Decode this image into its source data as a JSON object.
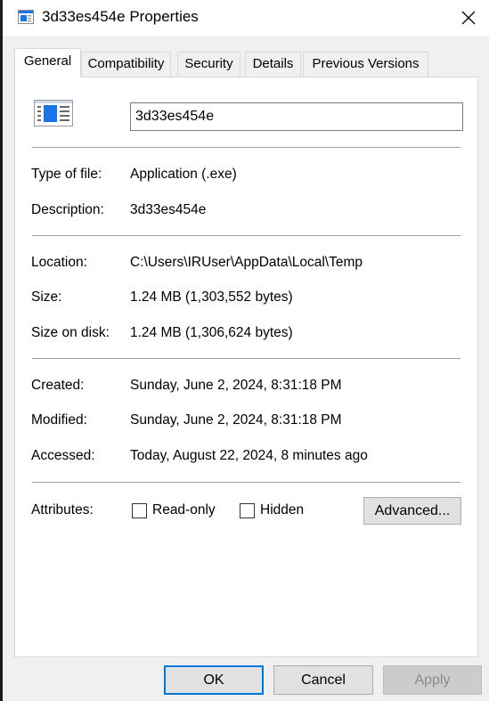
{
  "window": {
    "title": "3d33es454e Properties"
  },
  "tabs": [
    {
      "label": "General",
      "active": true
    },
    {
      "label": "Compatibility",
      "active": false
    },
    {
      "label": "Security",
      "active": false
    },
    {
      "label": "Details",
      "active": false
    },
    {
      "label": "Previous Versions",
      "active": false
    }
  ],
  "file": {
    "name": "3d33es454e",
    "icon": "application-window-icon"
  },
  "info": {
    "type_label": "Type of file:",
    "type_value": "Application (.exe)",
    "description_label": "Description:",
    "description_value": "3d33es454e",
    "location_label": "Location:",
    "location_value": "C:\\Users\\IRUser\\AppData\\Local\\Temp",
    "size_label": "Size:",
    "size_value": "1.24 MB (1,303,552 bytes)",
    "size_on_disk_label": "Size on disk:",
    "size_on_disk_value": "1.24 MB (1,306,624 bytes)",
    "created_label": "Created:",
    "created_value": "Sunday, June 2, 2024, 8:31:18 PM",
    "modified_label": "Modified:",
    "modified_value": "Sunday, June 2, 2024, 8:31:18 PM",
    "accessed_label": "Accessed:",
    "accessed_value": "Today, August 22, 2024, 8 minutes ago"
  },
  "attributes": {
    "label": "Attributes:",
    "readonly_label": "Read-only",
    "readonly_checked": false,
    "hidden_label": "Hidden",
    "hidden_checked": false,
    "advanced_label": "Advanced..."
  },
  "buttons": {
    "ok": "OK",
    "cancel": "Cancel",
    "apply": "Apply"
  },
  "colors": {
    "accent": "#0078d7",
    "icon_blue": "#1a73e8"
  }
}
